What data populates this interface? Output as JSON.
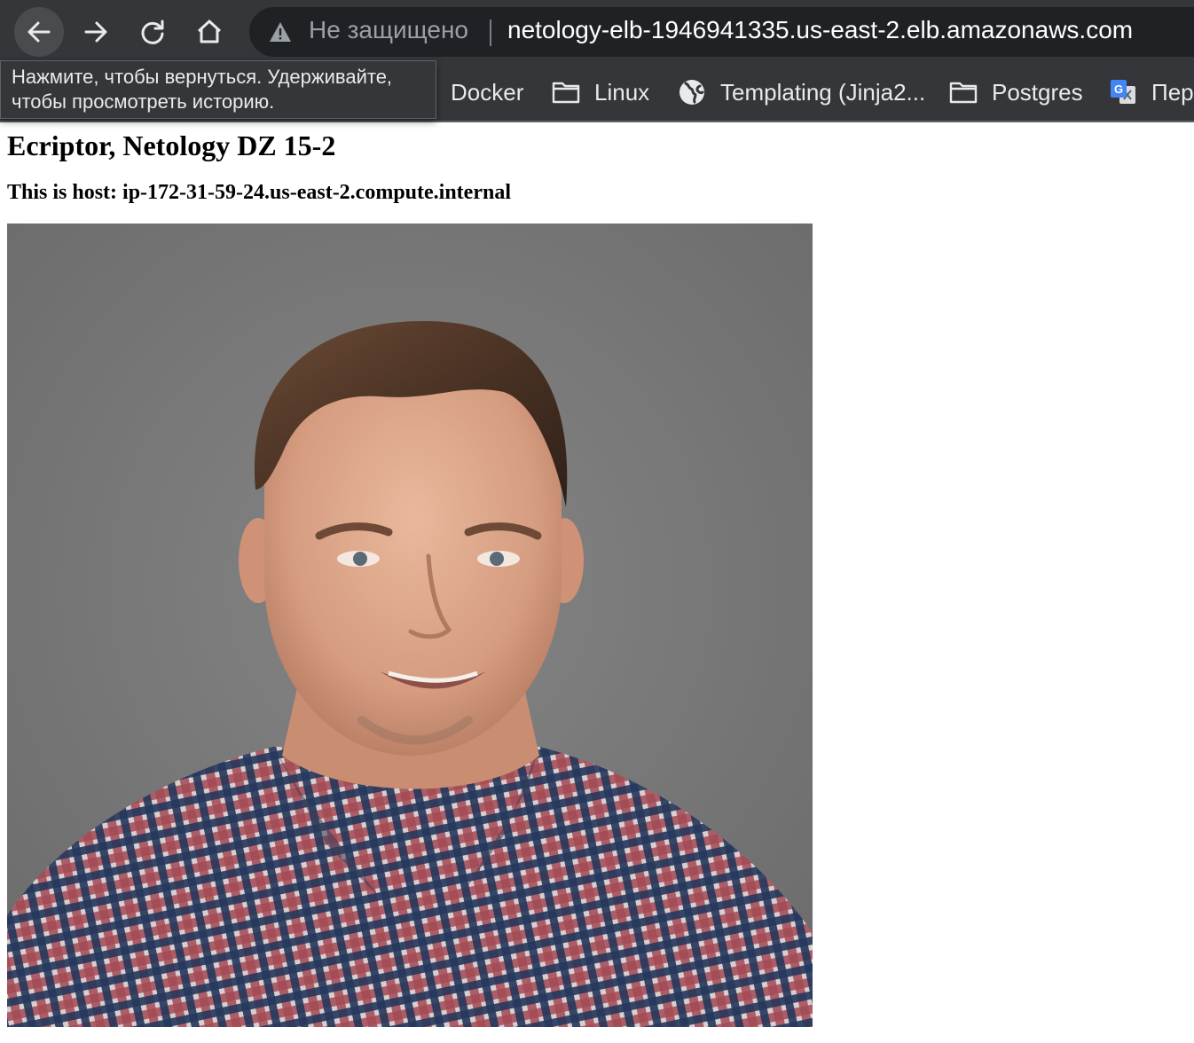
{
  "toolbar": {
    "back_icon": "arrow-left-icon",
    "forward_icon": "arrow-right-icon",
    "reload_icon": "reload-icon",
    "home_icon": "home-icon",
    "omnibox": {
      "security_icon": "warning-triangle-icon",
      "security_label": "Не защищено",
      "url": "netology-elb-1946941335.us-east-2.elb.amazonaws.com"
    }
  },
  "tooltip": {
    "line1": "Нажмите, чтобы вернуться. Удерживайте,",
    "line2": "чтобы просмотреть историю."
  },
  "bookmarks": [
    {
      "label": "Docker",
      "icon": ""
    },
    {
      "label": "Linux",
      "icon": "folder-icon"
    },
    {
      "label": "Templating (Jinja2...",
      "icon": "globe-icon"
    },
    {
      "label": "Postgres",
      "icon": "folder-icon"
    },
    {
      "label": "Пер",
      "icon": "translate-icon"
    }
  ],
  "page": {
    "heading": "Ecriptor, Netology DZ 15-2",
    "subheading": "This is host: ip-172-31-59-24.us-east-2.compute.internal"
  },
  "colors": {
    "chrome_bg": "#35363a",
    "omnibox_bg": "#202124",
    "photo_bg": "#777777"
  }
}
